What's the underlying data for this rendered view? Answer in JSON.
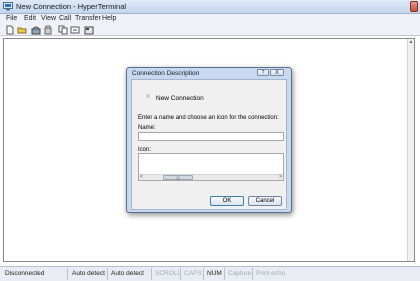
{
  "window": {
    "title": "New Connection - HyperTerminal"
  },
  "menu": {
    "items": [
      "File",
      "Edit",
      "View",
      "Call",
      "Transfer",
      "Help"
    ]
  },
  "toolbar": {
    "buttons": [
      "new-document-icon",
      "open-folder-icon",
      "call-icon",
      "disconnect-icon",
      "send-icon",
      "properties-icon"
    ]
  },
  "dialog": {
    "title": "Connection Description",
    "help_label": "?",
    "close_label": "X",
    "connection_name": "New Connection",
    "prompt": "Enter a name and choose an icon for the connection:",
    "name_label": "Name:",
    "name_value": "",
    "icon_label": "Icon:",
    "scroll_left": "<",
    "scroll_right": ">",
    "scroll_thumb": "|||",
    "ok_label": "OK",
    "cancel_label": "Cancel"
  },
  "status": {
    "connection": "Disconnected",
    "detect1": "Auto detect",
    "detect2": "Auto detect",
    "scroll": "SCROLL",
    "caps": "CAPS",
    "num": "NUM",
    "capture": "Capture",
    "print_echo": "Print echo"
  },
  "colors": {
    "active_text": "#1a1a1a",
    "inactive_text": "#a3a8b0",
    "dialog_frame": "#c6d9f0"
  }
}
